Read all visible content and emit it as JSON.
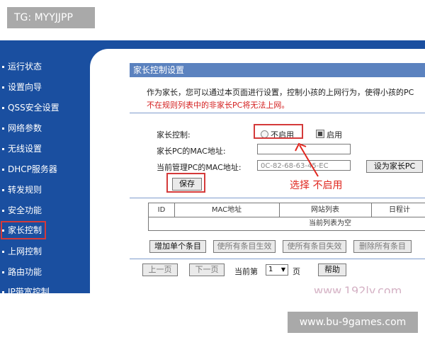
{
  "overlay": {
    "top_left_tag": "TG: MYYJJPP",
    "bottom_right_tag": "www.bu-9games.com"
  },
  "sidebar": {
    "items": [
      {
        "label": "运行状态"
      },
      {
        "label": "设置向导"
      },
      {
        "label": "QSS安全设置"
      },
      {
        "label": "网络参数"
      },
      {
        "label": "无线设置"
      },
      {
        "label": "DHCP服务器"
      },
      {
        "label": "转发规则"
      },
      {
        "label": "安全功能"
      },
      {
        "label": "家长控制",
        "active": true
      },
      {
        "label": "上网控制"
      },
      {
        "label": "路由功能"
      },
      {
        "label": "IP带宽控制"
      }
    ]
  },
  "panel": {
    "title": "家长控制设置",
    "description": "作为家长，您可以通过本页面进行设置，控制小孩的上网行为，使得小孩的PC",
    "warning": "不在规则列表中的非家长PC将无法上网。",
    "parental_control_label": "家长控制:",
    "option_disable": "不启用",
    "option_enable": "启用",
    "parent_mac_label": "家长PC的MAC地址:",
    "parent_mac_value": "",
    "current_mac_label": "当前管理PC的MAC地址:",
    "current_mac_value": "0C-82-68-63-45-EC",
    "set_as_parent_button": "设为家长PC",
    "save_button": "保存",
    "annotation": "选择 不启用",
    "table": {
      "headers": [
        "ID",
        "MAC地址",
        "网站列表",
        "日程计"
      ],
      "empty_text": "当前列表为空"
    },
    "actions": {
      "add_entry": "增加单个条目",
      "enable_all": "使所有条目生效",
      "disable_all": "使所有条目失效",
      "delete_all": "删除所有条目"
    },
    "pagination": {
      "prev": "上一页",
      "next": "下一页",
      "current_page_label": "当前第",
      "page_value": "1",
      "page_suffix": "页",
      "help": "帮助"
    },
    "watermark": "www.192ly.com"
  },
  "colors": {
    "sidebar_bg": "#1a4fa0",
    "panel_title_bg": "#5b82bf",
    "annotation_red": "#d43a3a",
    "warning_red": "#d42020"
  }
}
